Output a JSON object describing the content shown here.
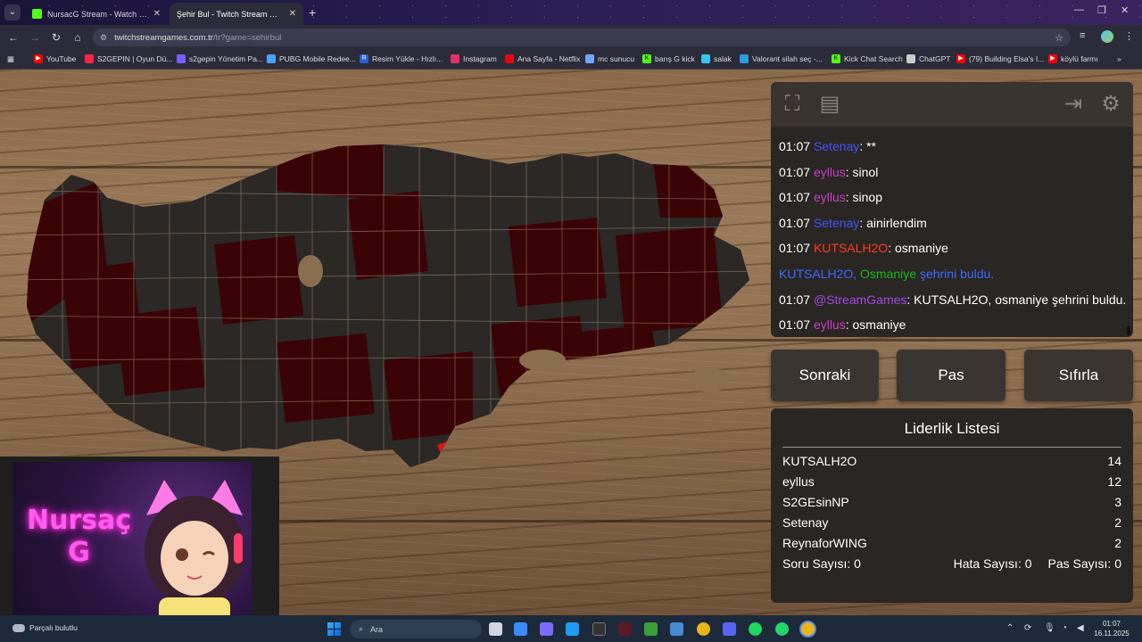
{
  "browser": {
    "tabs": [
      {
        "title": "NursacG Stream - Watch Live o",
        "favicon_color": "#53fc18"
      },
      {
        "title": "Şehir Bul - Twitch Stream Game",
        "favicon_color": "#ffffff"
      }
    ],
    "url_host": "twitchstreamgames.com.tr",
    "url_path": "/tr?game=sehirbul",
    "bookmarks": [
      {
        "label": "YouTube",
        "color": "#ff0000"
      },
      {
        "label": "S2GEPIN | Oyun Dü...",
        "color": "#ff2244"
      },
      {
        "label": "s2gepin Yönetim Pa...",
        "color": "#7a5cff"
      },
      {
        "label": "PUBG Mobile Redee...",
        "color": "#4aa3ff"
      },
      {
        "label": "Resim Yükle - Hızlı...",
        "color": "#2b5fd9"
      },
      {
        "label": "Instagram",
        "color": "#e1306c"
      },
      {
        "label": "Ana Sayfa - Netflix",
        "color": "#e50914"
      },
      {
        "label": "mc sunucu",
        "color": "#6fa8ff"
      },
      {
        "label": "barış G kick",
        "color": "#53fc18"
      },
      {
        "label": "salak",
        "color": "#36c5f0"
      },
      {
        "label": "Valorant silah seç -...",
        "color": "#2c9be0"
      },
      {
        "label": "Kick Chat Search",
        "color": "#53fc18"
      },
      {
        "label": "ChatGPT",
        "color": "#cccccc"
      },
      {
        "label": "(79) Building Elsa's I...",
        "color": "#ff0000"
      },
      {
        "label": "köylü farmı",
        "color": "#ff0000"
      }
    ]
  },
  "chat": [
    {
      "time": "01:07",
      "user": "Setenay",
      "user_color": "c-blue",
      "text": ": **"
    },
    {
      "time": "01:07",
      "user": "eyllus",
      "user_color": "c-pink",
      "text": ": sinol"
    },
    {
      "time": "01:07",
      "user": "eyllus",
      "user_color": "c-pink",
      "text": ": sinop"
    },
    {
      "time": "01:07",
      "user": "Setenay",
      "user_color": "c-blue",
      "text": ": ainirlendim"
    },
    {
      "time": "01:07",
      "user": "KUTSALH2O",
      "user_color": "c-red",
      "text": ": osmaniye"
    },
    {
      "system": true,
      "user": "KUTSALH2O",
      "city": "Osmaniye",
      "text": " şehrini buldu."
    },
    {
      "time": "01:07",
      "user": "@StreamGames",
      "user_color": "c-mag",
      "text": ": KUTSALH2O, osmaniye şehrini buldu."
    },
    {
      "time": "01:07",
      "user": "eyllus",
      "user_color": "c-pink",
      "text": ": osmaniye"
    }
  ],
  "buttons": {
    "next": "Sonraki",
    "pass": "Pas",
    "reset": "Sıfırla"
  },
  "leaderboard": {
    "title": "Liderlik Listesi",
    "rows": [
      {
        "name": "KUTSALH2O",
        "score": "14"
      },
      {
        "name": "eyllus",
        "score": "12"
      },
      {
        "name": "S2GEsinNP",
        "score": "3"
      },
      {
        "name": "Setenay",
        "score": "2"
      },
      {
        "name": "ReynaforWING",
        "score": "2"
      }
    ],
    "questions_label": "Soru Sayısı: 0",
    "errors_label": "Hata Sayısı: 0",
    "passes_label": "Pas Sayısı: 0"
  },
  "overlay": {
    "line1": "Nursaç",
    "line2": "G"
  },
  "taskbar": {
    "weather_label": "Parçalı bulutlu",
    "search_placeholder": "Ara",
    "time": "01:07",
    "date": "16.11.2025"
  },
  "colors": {
    "found_city": "#e0121b",
    "highlighted_city": "#3a0406",
    "unfound_city": "#2b2826"
  }
}
